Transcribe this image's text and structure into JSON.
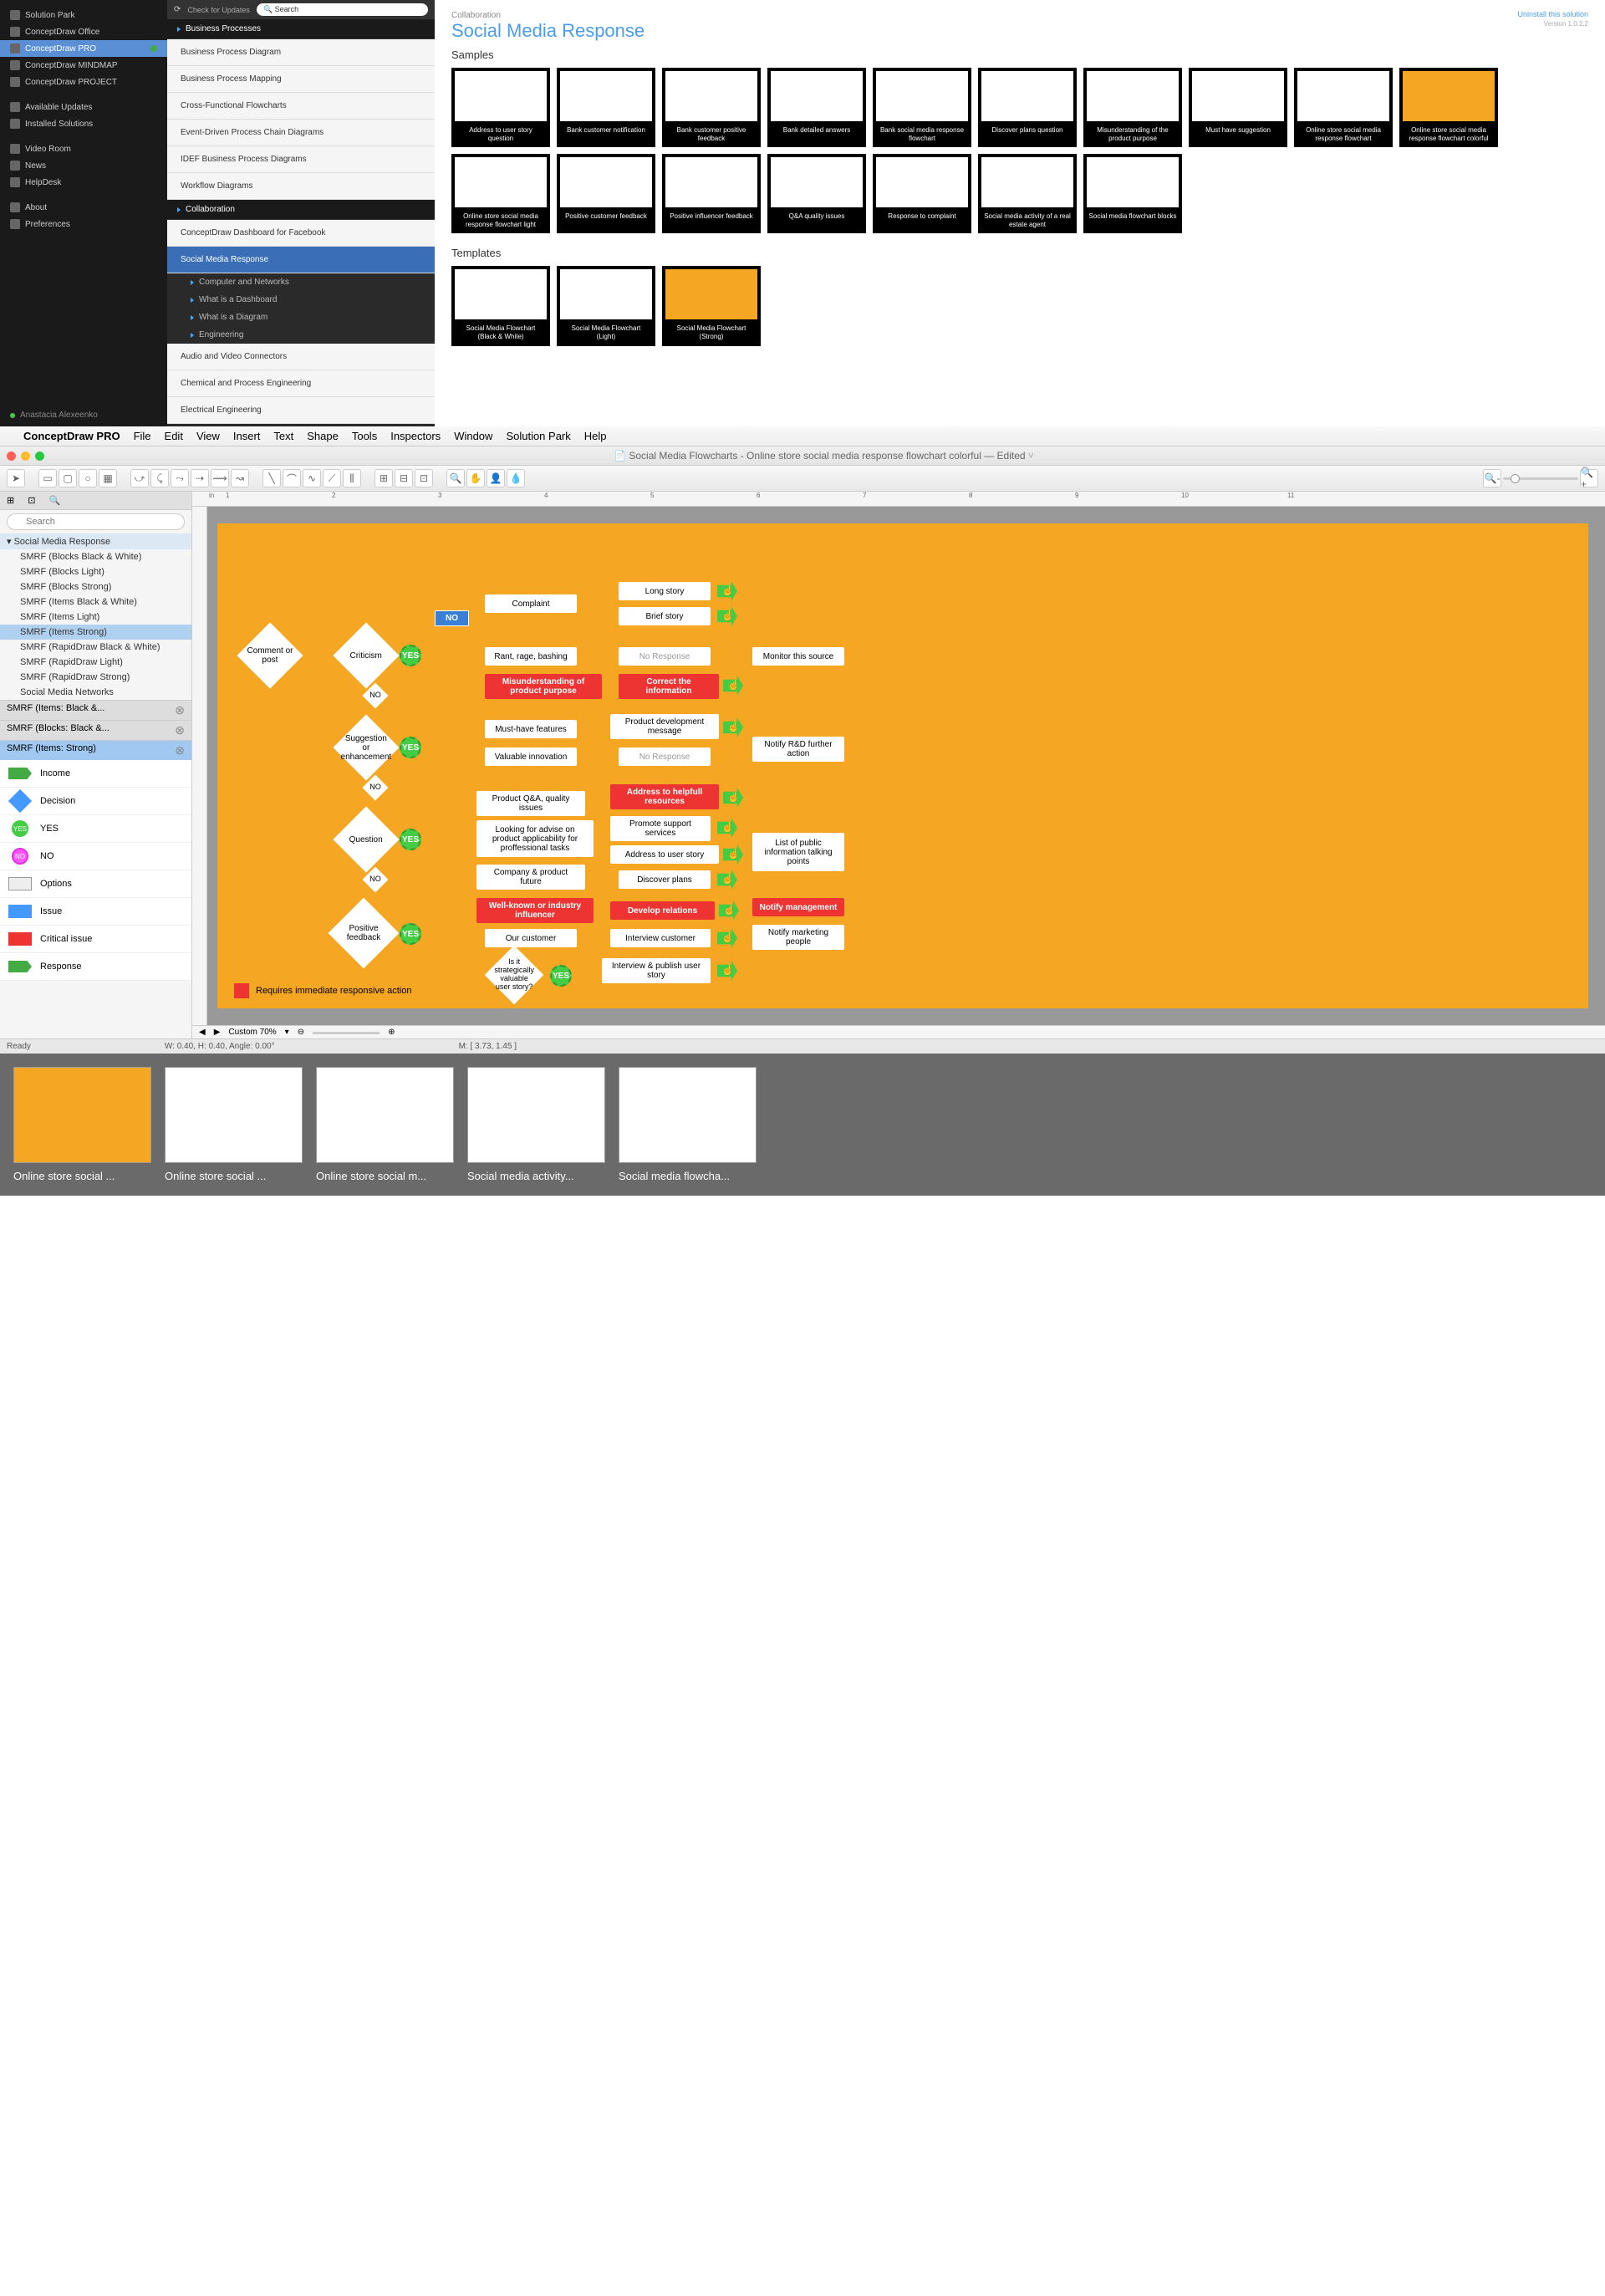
{
  "top_panel": {
    "col1": {
      "items": [
        {
          "label": "Solution Park",
          "icon": true
        },
        {
          "label": "ConceptDraw Office",
          "icon": true
        },
        {
          "label": "ConceptDraw PRO",
          "icon": true,
          "dot": true,
          "selected": true
        },
        {
          "label": "ConceptDraw MINDMAP",
          "icon": true
        },
        {
          "label": "ConceptDraw PROJECT",
          "icon": true
        }
      ],
      "items2": [
        {
          "label": "Available Updates"
        },
        {
          "label": "Installed Solutions"
        }
      ],
      "items3": [
        {
          "label": "Video Room"
        },
        {
          "label": "News"
        },
        {
          "label": "HelpDesk"
        }
      ],
      "items4": [
        {
          "label": "About"
        },
        {
          "label": "Preferences"
        }
      ],
      "user": "Anastacia Alexeenko"
    },
    "col2": {
      "check": "Check for Updates",
      "search": "Search",
      "categories": [
        {
          "label": "Business Processes",
          "type": "cat"
        },
        {
          "label": "Business Process Diagram",
          "type": "item"
        },
        {
          "label": "Business Process Mapping",
          "type": "item"
        },
        {
          "label": "Cross-Functional Flowcharts",
          "type": "item"
        },
        {
          "label": "Event-Driven Process Chain Diagrams",
          "type": "item"
        },
        {
          "label": "IDEF Business Process Diagrams",
          "type": "item"
        },
        {
          "label": "Workflow Diagrams",
          "type": "item"
        },
        {
          "label": "Collaboration",
          "type": "cat"
        },
        {
          "label": "ConceptDraw Dashboard for Facebook",
          "type": "item"
        },
        {
          "label": "Social Media Response",
          "type": "item",
          "active": true
        },
        {
          "label": "Computer and Networks",
          "type": "sub"
        },
        {
          "label": "What is a Dashboard",
          "type": "sub"
        },
        {
          "label": "What is a Diagram",
          "type": "sub"
        },
        {
          "label": "Engineering",
          "type": "sub"
        },
        {
          "label": "Audio and Video Connectors",
          "type": "item"
        },
        {
          "label": "Chemical and Process Engineering",
          "type": "item"
        },
        {
          "label": "Electrical Engineering",
          "type": "item"
        }
      ]
    },
    "main": {
      "breadcrumb": "Collaboration",
      "uninstall": "Uninstall this solution",
      "version": "Version 1.0.2.2",
      "title": "Social Media Response",
      "samples_label": "Samples",
      "templates_label": "Templates",
      "samples": [
        "Address to user story question",
        "Bank customer notification",
        "Bank customer positive feedback",
        "Bank detailed answers",
        "Bank social media response flowchart",
        "Discover plans question",
        "Misunderstanding of the product purpose",
        "Must have suggestion",
        "Online store social media response flowchart",
        "Online store social media response flowchart colorful",
        "Online store social media response flowchart light",
        "Positive customer feedback",
        "Positive influencer feedback",
        "Q&A quality issues",
        "Response to complaint",
        "Social media activity of a real estate agent",
        "Social media flowchart blocks"
      ],
      "templates": [
        "Social Media Flowchart (Black & White)",
        "Social Media Flowchart (Light)",
        "Social Media Flowchart (Strong)"
      ]
    }
  },
  "mac": {
    "menu": [
      "ConceptDraw PRO",
      "File",
      "Edit",
      "View",
      "Insert",
      "Text",
      "Shape",
      "Tools",
      "Inspectors",
      "Window",
      "Solution Park",
      "Help"
    ],
    "title": "Social Media Flowcharts - Online store social media response flowchart colorful — Edited",
    "search_placeholder": "Search",
    "tree_header": "Social Media Response",
    "tree": [
      "SMRF (Blocks Black & White)",
      "SMRF (Blocks Light)",
      "SMRF (Blocks Strong)",
      "SMRF (Items Black & White)",
      "SMRF (Items Light)",
      "SMRF (Items Strong)",
      "SMRF (RapidDraw Black & White)",
      "SMRF (RapidDraw Light)",
      "SMRF (RapidDraw Strong)",
      "Social Media Networks"
    ],
    "tree_selected": "SMRF (Items Strong)",
    "libs": [
      "SMRF (Items: Black &...",
      "SMRF (Blocks: Black &...",
      "SMRF (Items: Strong)"
    ],
    "shapes": [
      "Income",
      "Decision",
      "YES",
      "NO",
      "Options",
      "Issue",
      "Critical issue",
      "Response"
    ],
    "zoom": "Custom 70%",
    "status_ready": "Ready",
    "status_wh": "W: 0.40,  H: 0.40,  Angle: 0.00°",
    "status_m": "M: [ 3.73, 1.45 ]"
  },
  "flowchart": {
    "start": "Comment or post",
    "d1": "Criticism",
    "d2": "Suggestion or enhancement",
    "d3": "Question",
    "d4": "Positive feedback",
    "d5": "Is it strategically valuable user story?",
    "complaint": "Complaint",
    "rant": "Rant, rage, bashing",
    "misund": "Misunderstanding of product purpose",
    "musthave": "Must-have features",
    "valinnov": "Valuable innovation",
    "qa": "Product Q&A, quality issues",
    "advise": "Looking for advise on product applicability for proffessional tasks",
    "company": "Company & product future",
    "influencer": "Well-known or industry influencer",
    "ourcust": "Our customer",
    "long": "Long story",
    "brief": "Brief story",
    "noresp": "No Response",
    "correct": "Correct the information",
    "pdmsg": "Product development message",
    "noresp2": "No Response",
    "helpful": "Address to helpfull resources",
    "promote": "Promote support services",
    "addrus": "Address to user story",
    "discover": "Discover plans",
    "develop": "Develop relations",
    "interview": "Interview customer",
    "intpub": "Interview & publish user story",
    "monitor": "Monitor this source",
    "notifyrd": "Notify R&D further action",
    "listpub": "List of public information talking points",
    "notifymgmt": "Notify management",
    "notifymkt": "Notify marketing people",
    "yes": "YES",
    "no": "NO",
    "no_float": "NO",
    "legend": "Requires immediate responsive action"
  },
  "bottom": [
    "Online store social ...",
    "Online store social ...",
    "Online store social m...",
    "Social media activity...",
    "Social media flowcha..."
  ]
}
